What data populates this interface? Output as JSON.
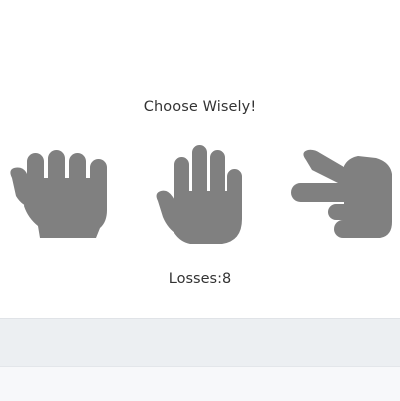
{
  "game": {
    "prompt": "Choose Wisely!",
    "score_text": "Losses:8",
    "hand_color": "#808080"
  },
  "choices": [
    {
      "id": "rock",
      "icon": "fist-icon"
    },
    {
      "id": "paper",
      "icon": "open-hand-icon"
    },
    {
      "id": "scissors",
      "icon": "scissors-hand-icon"
    }
  ]
}
